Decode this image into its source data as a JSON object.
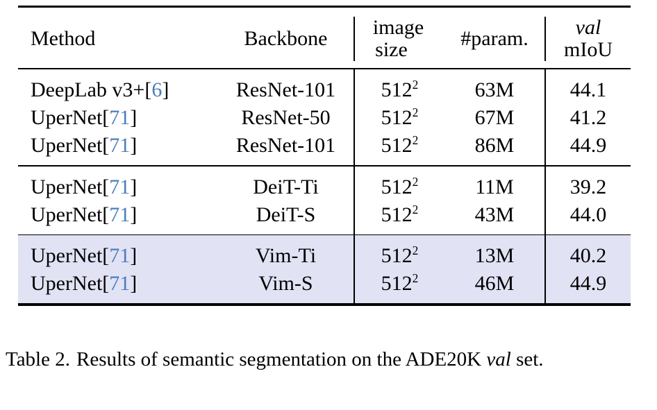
{
  "table": {
    "columns": [
      {
        "key": "method",
        "label": "Method"
      },
      {
        "key": "backbone",
        "label": "Backbone"
      },
      {
        "key": "imgsize",
        "label_line1": "image",
        "label_line2": "size"
      },
      {
        "key": "param",
        "label": "#param."
      },
      {
        "key": "miou",
        "label_line1": "val",
        "label_line2": "mIoU"
      }
    ],
    "groups": [
      {
        "id": "cnn-backbones",
        "highlight": false,
        "rows": [
          {
            "method_name": "DeepLab v3+",
            "citation_open": "[",
            "citation_num": "6",
            "citation_close": "]",
            "backbone": "ResNet-101",
            "imgsize_base": "512",
            "imgsize_exp": "2",
            "param": "63M",
            "miou": "44.1"
          },
          {
            "method_name": "UperNet",
            "citation_open": "[",
            "citation_num": "71",
            "citation_close": "]",
            "backbone": "ResNet-50",
            "imgsize_base": "512",
            "imgsize_exp": "2",
            "param": "67M",
            "miou": "41.2"
          },
          {
            "method_name": "UperNet",
            "citation_open": "[",
            "citation_num": "71",
            "citation_close": "]",
            "backbone": "ResNet-101",
            "imgsize_base": "512",
            "imgsize_exp": "2",
            "param": "86M",
            "miou": "44.9"
          }
        ]
      },
      {
        "id": "deit-backbones",
        "highlight": false,
        "rows": [
          {
            "method_name": "UperNet",
            "citation_open": "[",
            "citation_num": "71",
            "citation_close": "]",
            "backbone": "DeiT-Ti",
            "imgsize_base": "512",
            "imgsize_exp": "2",
            "param": "11M",
            "miou": "39.2"
          },
          {
            "method_name": "UperNet",
            "citation_open": "[",
            "citation_num": "71",
            "citation_close": "]",
            "backbone": "DeiT-S",
            "imgsize_base": "512",
            "imgsize_exp": "2",
            "param": "43M",
            "miou": "44.0"
          }
        ]
      },
      {
        "id": "vim-backbones",
        "highlight": true,
        "rows": [
          {
            "method_name": "UperNet",
            "citation_open": "[",
            "citation_num": "71",
            "citation_close": "]",
            "backbone": "Vim-Ti",
            "imgsize_base": "512",
            "imgsize_exp": "2",
            "param": "13M",
            "miou": "40.2"
          },
          {
            "method_name": "UperNet",
            "citation_open": "[",
            "citation_num": "71",
            "citation_close": "]",
            "backbone": "Vim-S",
            "imgsize_base": "512",
            "imgsize_exp": "2",
            "param": "46M",
            "miou": "44.9"
          }
        ]
      }
    ]
  },
  "caption": {
    "label": "Table 2.",
    "text_before_italic": "Results of semantic segmentation on the ADE20K",
    "italic_word": "val",
    "text_after_italic": "set."
  },
  "colors": {
    "citation_blue": "#4a7ebb",
    "highlight_row": "#e2e2f5",
    "rule_black": "#000000",
    "page_background": "#ffffff"
  }
}
